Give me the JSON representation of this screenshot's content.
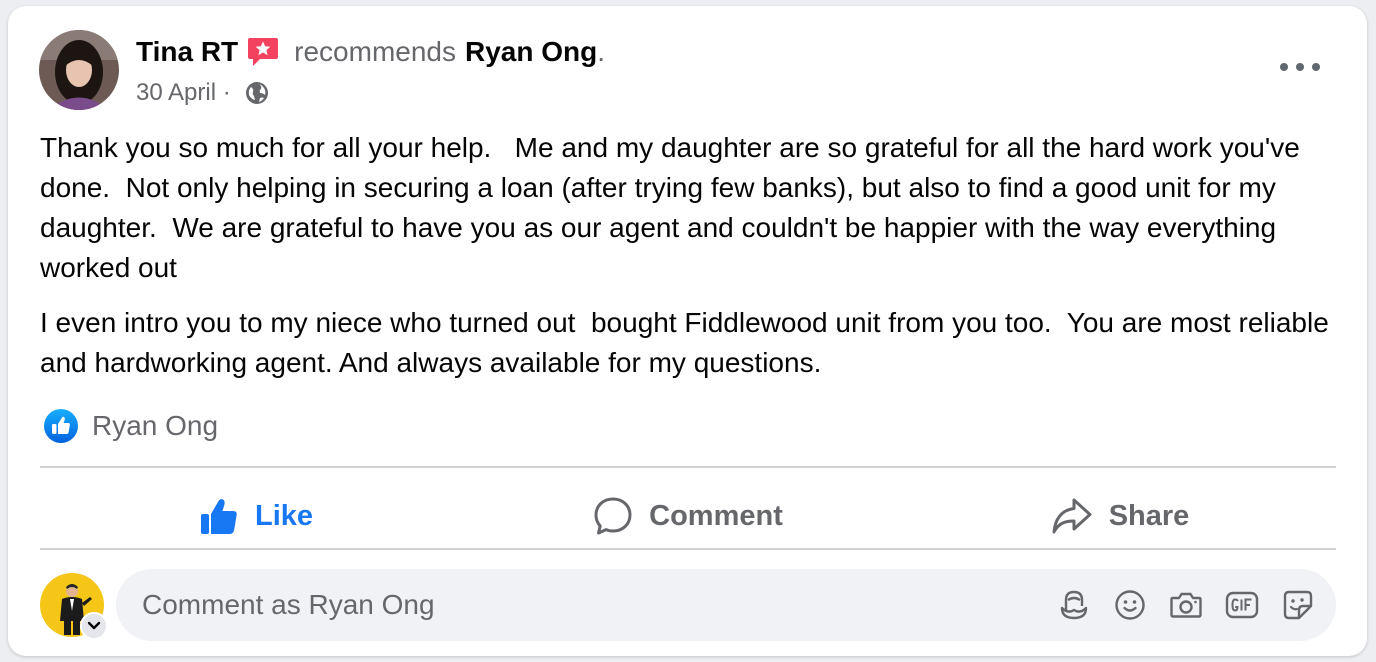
{
  "post": {
    "author": "Tina RT",
    "verb": "recommends",
    "target": "Ryan Ong",
    "target_suffix": ".",
    "date": "30 April",
    "meta_sep": " · ",
    "paragraphs": [
      "Thank you so much for all your help.   Me and my daughter are so grateful for all the hard work you've done.  Not only helping in securing a loan (after trying few banks), but also to find a good unit for my daughter.  We are grateful to have you as our agent and couldn't be happier with the way everything worked out",
      "I even intro you to my niece who turned out  bought Fiddlewood unit from you too.  You are most reliable and hardworking agent. And always available for my questions."
    ],
    "reaction_name": "Ryan Ong"
  },
  "actions": {
    "like": "Like",
    "comment": "Comment",
    "share": "Share"
  },
  "composer": {
    "placeholder": "Comment as Ryan Ong"
  },
  "icons": {
    "badge": "recommend-badge-icon",
    "globe": "globe-icon",
    "more": "more-options-icon",
    "reaction": "like-reaction-icon",
    "tools": [
      "avatar-sticker-icon",
      "emoji-icon",
      "camera-icon",
      "gif-icon",
      "sticker-icon"
    ]
  },
  "colors": {
    "accent": "#1877f2",
    "badge": "#f3425f",
    "muted": "#65676b",
    "text": "#050505"
  }
}
